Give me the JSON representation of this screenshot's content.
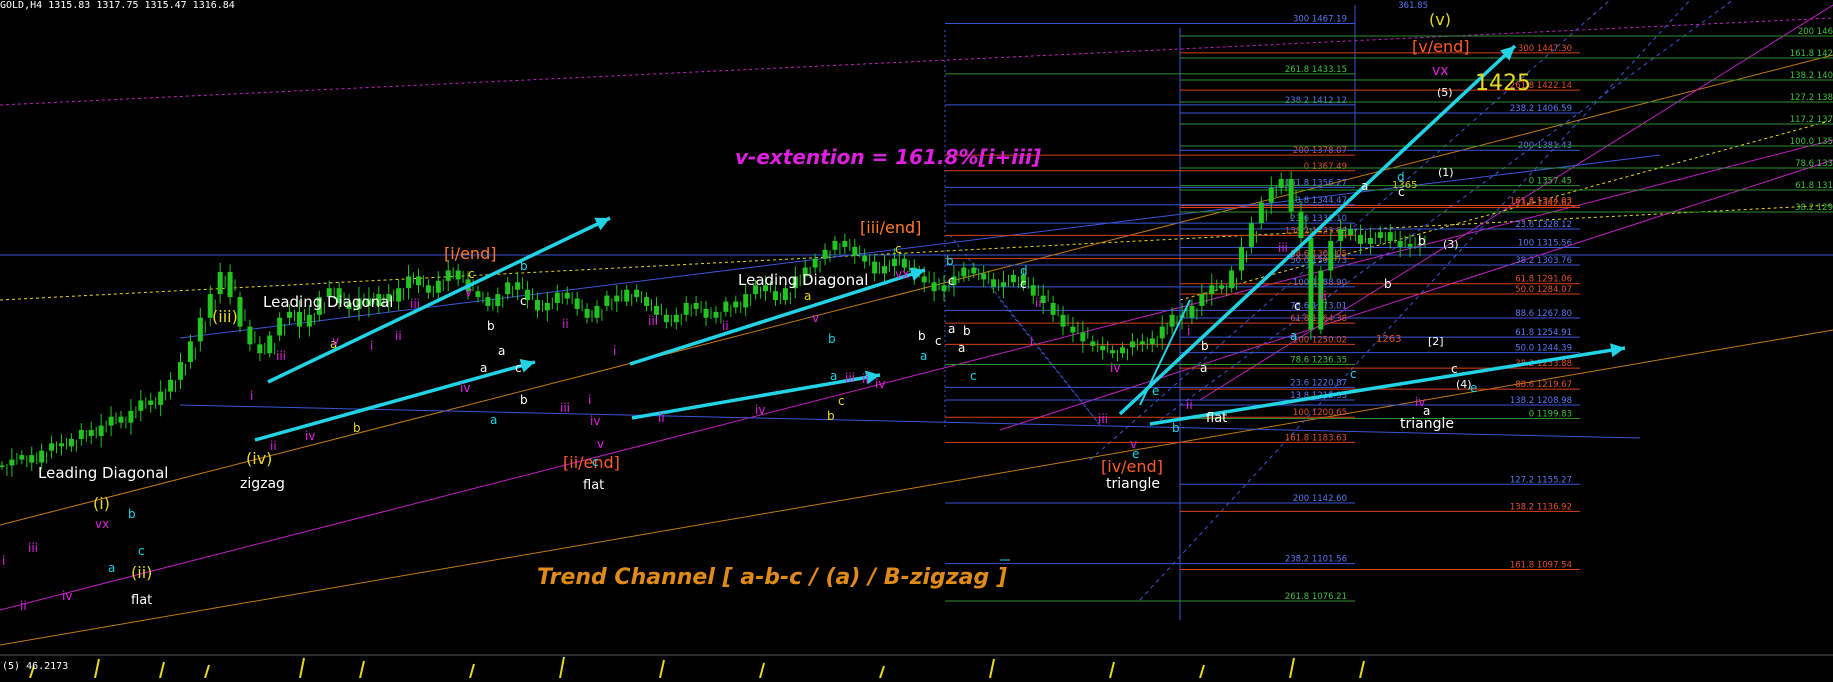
{
  "header": {
    "symbol": "GOLD,H4",
    "ohlc": "1315.83 1317.75 1315.47 1316.84"
  },
  "sub_header": "(5) 46.2173",
  "chart_data": {
    "type": "line",
    "title": "",
    "price_series": [
      1168,
      1172,
      1175,
      1170,
      1178,
      1183,
      1181,
      1186,
      1192,
      1188,
      1195,
      1201,
      1197,
      1205,
      1212,
      1209,
      1218,
      1226,
      1238,
      1252,
      1268,
      1284,
      1299,
      1282,
      1262,
      1250,
      1244,
      1256,
      1268,
      1272,
      1262,
      1270,
      1282,
      1288,
      1278,
      1274,
      1281,
      1276,
      1284,
      1279,
      1288,
      1296,
      1290,
      1285,
      1293,
      1300,
      1294,
      1286,
      1282,
      1276,
      1284,
      1292,
      1287,
      1280,
      1273,
      1278,
      1285,
      1281,
      1274,
      1268,
      1276,
      1283,
      1279,
      1287,
      1282,
      1276,
      1270,
      1265,
      1270,
      1278,
      1274,
      1268,
      1272,
      1279,
      1275,
      1284,
      1290,
      1286,
      1280,
      1288,
      1296,
      1302,
      1308,
      1314,
      1320,
      1316,
      1310,
      1306,
      1298,
      1303,
      1308,
      1302,
      1296,
      1292,
      1286,
      1290,
      1296,
      1302,
      1298,
      1294,
      1289,
      1292,
      1297,
      1290,
      1283,
      1278,
      1270,
      1262,
      1258,
      1252,
      1249,
      1246,
      1244,
      1248,
      1252,
      1250,
      1254,
      1262,
      1270,
      1268,
      1276,
      1284,
      1290,
      1288,
      1300,
      1316,
      1332,
      1346,
      1356,
      1362,
      1340,
      1322,
      1260,
      1300,
      1320,
      1328,
      1324,
      1318,
      1322,
      1326,
      1320,
      1316,
      1318,
      1317
    ],
    "fib_levels": [
      {
        "name": "300",
        "value": "1467.19"
      },
      {
        "name": "300",
        "value": "1447.30"
      },
      {
        "name": "261.8",
        "value": "1433.15"
      },
      {
        "name": "261.8",
        "value": "1422.14"
      },
      {
        "name": "238.2",
        "value": "1412.12"
      },
      {
        "name": "238.2",
        "value": "1406.59"
      },
      {
        "name": "200",
        "value": "1378.07"
      },
      {
        "name": "200",
        "value": "1381.43"
      },
      {
        "name": "0",
        "value": "1367.49"
      },
      {
        "name": "0",
        "value": "1357.45"
      },
      {
        "name": "161.8",
        "value": "1356.27"
      },
      {
        "name": "161.8",
        "value": "1344.03"
      },
      {
        "name": "13.8",
        "value": "1344.47"
      },
      {
        "name": "13.8",
        "value": "1342.62"
      },
      {
        "name": "23.6",
        "value": "1332.10"
      },
      {
        "name": "23.6",
        "value": "1328.12"
      },
      {
        "name": "138.2",
        "value": "1323.80"
      },
      {
        "name": "100",
        "value": "1315.56"
      },
      {
        "name": "88.6",
        "value": "1308.05"
      },
      {
        "name": "38.2",
        "value": "1303.76"
      },
      {
        "name": "50.0",
        "value": "1303.73"
      },
      {
        "name": "61.8",
        "value": "1291.06"
      },
      {
        "name": "100",
        "value": "1288.90"
      },
      {
        "name": "50.0",
        "value": "1284.07"
      },
      {
        "name": "78.6",
        "value": "1273.01"
      },
      {
        "name": "88.6",
        "value": "1267.80"
      },
      {
        "name": "61.8",
        "value": "1264.38"
      },
      {
        "name": "61.8",
        "value": "1254.91"
      },
      {
        "name": "100",
        "value": "1250.02"
      },
      {
        "name": "50.0",
        "value": "1244.39"
      },
      {
        "name": "78.6",
        "value": "1236.35"
      },
      {
        "name": "38.2",
        "value": "1233.88"
      },
      {
        "name": "23.6",
        "value": "1220.87"
      },
      {
        "name": "88.6",
        "value": "1219.67"
      },
      {
        "name": "13.8",
        "value": "1212.33"
      },
      {
        "name": "138.2",
        "value": "1208.98"
      },
      {
        "name": "100",
        "value": "1200.65"
      },
      {
        "name": "0",
        "value": "1199.83"
      },
      {
        "name": "161.8",
        "value": "1183.63"
      },
      {
        "name": "127.2",
        "value": "1155.27"
      },
      {
        "name": "200",
        "value": "1142.60"
      },
      {
        "name": "138.2",
        "value": "1136.92"
      },
      {
        "name": "238.2",
        "value": "1101.56"
      },
      {
        "name": "161.8",
        "value": "1097.54"
      },
      {
        "name": "261.8",
        "value": "1076.21"
      }
    ],
    "right_edge_levels": [
      "200 146",
      "161.8 142",
      "138.2 140",
      "127.2 138",
      "117.2 137",
      "100.0 135",
      "78.6 133",
      "61.8 131",
      "38.2 129"
    ],
    "top_level": "361.85",
    "annotations": [
      "(v)",
      "[v/end]",
      "vx",
      "1425",
      "(5)",
      "(1)",
      "(3)",
      "(4)",
      "[2]",
      "1365",
      "1263",
      "v-extention = 161.8%[i+iii]",
      "[iii/end]",
      "[i/end]",
      "[ii/end]",
      "[iv/end]",
      "Leading Diagonal",
      "Leading Diagonal",
      "Leading Diagonal",
      "(iii)",
      "(iv)",
      "(i)",
      "(ii)",
      "zigzag",
      "flat",
      "flat",
      "flat",
      "triangle",
      "triangle",
      "Trend Channel  [ a-b-c / (a) / B-zigzag ]"
    ],
    "colors": {
      "background": "#000000",
      "candles": "#22c422",
      "arrows": "#22d3e6",
      "magenta": "#e020e0",
      "orange": "#e08a1a",
      "yellow": "#e8d820",
      "blue_lines": "#3a56d8",
      "fib_red": "#d8401a",
      "fib_green": "#2f8f2f"
    }
  }
}
